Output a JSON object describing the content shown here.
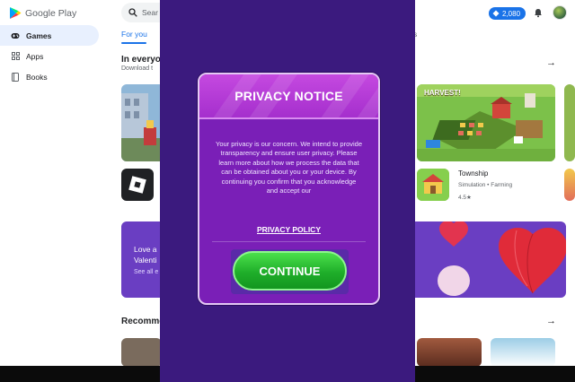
{
  "app": {
    "name": "Google Play",
    "logo_icon": "play-logo-icon"
  },
  "sidebar": {
    "items": [
      {
        "label": "Games",
        "icon": "gamepad-icon",
        "active": true
      },
      {
        "label": "Apps",
        "icon": "apps-grid-icon",
        "active": false
      },
      {
        "label": "Books",
        "icon": "book-icon",
        "active": false
      }
    ]
  },
  "header": {
    "search_placeholder": "Sear",
    "points": "2,080",
    "points_icon": "diamond-icon",
    "notification_icon": "bell-icon",
    "avatar_icon": "avatar-icon"
  },
  "tabs": {
    "active": "For you",
    "partial": "s"
  },
  "section_one": {
    "title": "In everyo",
    "subtitle": "Download t",
    "arrow": "→"
  },
  "featured_game": {
    "banner_text": "HARVEST!",
    "title": "Township",
    "meta": "Simulation • Farming",
    "rating": "4.5★"
  },
  "promo_banner": {
    "line1": "Love a",
    "line2": "Valenti",
    "link": "See all e"
  },
  "section_two": {
    "title": "Recomme",
    "arrow": "→"
  },
  "dialog": {
    "title": "PRIVACY NOTICE",
    "body": "Your privacy is our concern. We intend to provide transparency and ensure user privacy. Please learn more about how we process the data that can be obtained about you or your device. By continuing you confirm that you acknowledge and accept our",
    "policy_link": "PRIVACY POLICY",
    "continue_label": "CONTINUE"
  },
  "colors": {
    "overlay": "#3b1a7e",
    "dialog_body": "#7a1fb7",
    "dialog_header": "#c549e0",
    "continue_button": "#1fae2a",
    "google_blue": "#1a73e8",
    "nav_active_bg": "#e8f0fe"
  }
}
